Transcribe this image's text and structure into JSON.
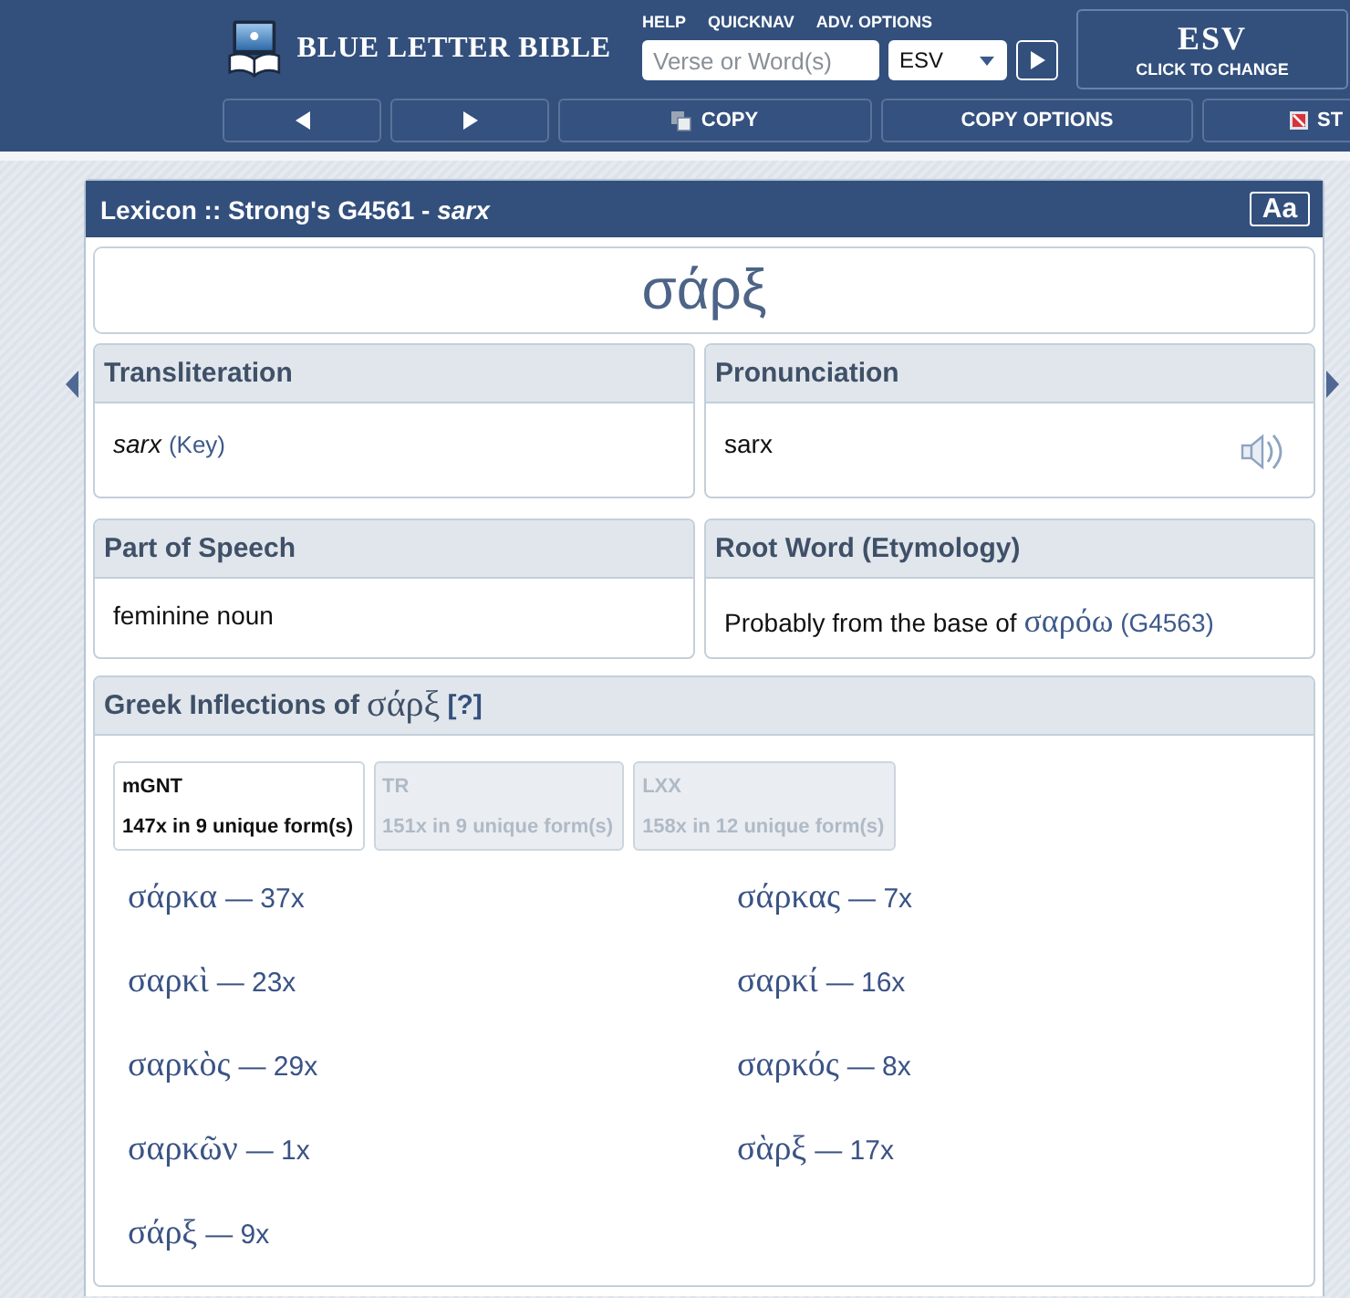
{
  "header": {
    "logo_text": "BLUE LETTER BIBLE",
    "nav_links": [
      "HELP",
      "QUICKNAV",
      "ADV. OPTIONS"
    ],
    "search": {
      "placeholder": "Verse or Word(s)"
    },
    "version_select": {
      "value": "ESV"
    },
    "version_box": {
      "title": "ESV",
      "subtitle": "CLICK TO CHANGE"
    }
  },
  "toolbar": [
    {
      "kind": "prev"
    },
    {
      "kind": "next"
    },
    {
      "kind": "copy",
      "label": "COPY"
    },
    {
      "kind": "options",
      "label": "COPY OPTIONS"
    },
    {
      "kind": "stop",
      "label": "ST"
    }
  ],
  "panel": {
    "title": "Lexicon :: Strong's G4561 - *sarx*",
    "font_button": "Aa",
    "lemma": "σάρξ",
    "transliteration": {
      "heading": "Transliteration",
      "value": "sarx",
      "key_link": "(Key)"
    },
    "pronunciation": {
      "heading": "Pronunciation",
      "value": "sarx"
    },
    "part_of_speech": {
      "heading": "Part of Speech",
      "value": "feminine noun"
    },
    "root_word": {
      "heading": "Root Word (Etymology)",
      "text": "Probably from the base of",
      "link_word": "σαρόω",
      "link_number": "(G4563)"
    },
    "inflections": {
      "heading": "Greek Inflections of",
      "lemma": "σάρξ",
      "help": "[?]",
      "tabs": [
        {
          "name": "mGNT",
          "summary": "147x in 9 unique form(s)",
          "selected": true
        },
        {
          "name": "TR",
          "summary": "151x in 9 unique form(s)",
          "selected": false
        },
        {
          "name": "LXX",
          "summary": "158x in 12 unique form(s)",
          "selected": false
        }
      ],
      "forms": [
        {
          "form": "σάρκα",
          "count": "— 37x"
        },
        {
          "form": "σάρκας",
          "count": "— 7x"
        },
        {
          "form": "σαρκὶ",
          "count": "— 23x"
        },
        {
          "form": "σαρκί",
          "count": "— 16x"
        },
        {
          "form": "σαρκὸς",
          "count": "— 29x"
        },
        {
          "form": "σαρκός",
          "count": "— 8x"
        },
        {
          "form": "σαρκῶν",
          "count": "— 1x"
        },
        {
          "form": "σὰρξ",
          "count": "— 17x"
        },
        {
          "form": "σάρξ",
          "count": "— 9x"
        }
      ]
    }
  }
}
